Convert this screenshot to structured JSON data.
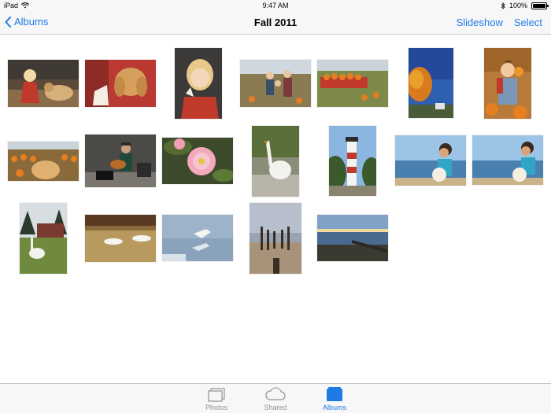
{
  "status": {
    "device": "iPad",
    "time": "9:47 AM",
    "battery_text": "100%"
  },
  "nav": {
    "back_label": "Albums",
    "title": "Fall 2011",
    "slideshow_label": "Slideshow",
    "select_label": "Select"
  },
  "photos": [
    {
      "name": "photo-girl-with-dog"
    },
    {
      "name": "photo-spaniel-dog"
    },
    {
      "name": "photo-blonde-girl-icecream"
    },
    {
      "name": "photo-family-pumpkin-patch"
    },
    {
      "name": "photo-pumpkin-wagon"
    },
    {
      "name": "photo-autumn-tree-sky"
    },
    {
      "name": "photo-boy-overalls-pumpkins"
    },
    {
      "name": "photo-pumpkin-field-bales"
    },
    {
      "name": "photo-street-guitarist"
    },
    {
      "name": "photo-pink-flower"
    },
    {
      "name": "photo-white-goose"
    },
    {
      "name": "photo-lighthouse"
    },
    {
      "name": "photo-boy-beach-pumpkin-1"
    },
    {
      "name": "photo-boy-beach-pumpkin-2"
    },
    {
      "name": "photo-goose-by-barn"
    },
    {
      "name": "photo-swans-field"
    },
    {
      "name": "photo-swans-water"
    },
    {
      "name": "photo-pier-posts"
    },
    {
      "name": "photo-lake-pier-sunset"
    }
  ],
  "tabs": [
    {
      "label": "Photos",
      "icon": "photos-icon",
      "active": false
    },
    {
      "label": "Shared",
      "icon": "cloud-icon",
      "active": false
    },
    {
      "label": "Albums",
      "icon": "folder-icon",
      "active": true
    }
  ],
  "colors": {
    "accent": "#1f7ae6",
    "inactive": "#929292",
    "bar": "#f7f7f7"
  }
}
